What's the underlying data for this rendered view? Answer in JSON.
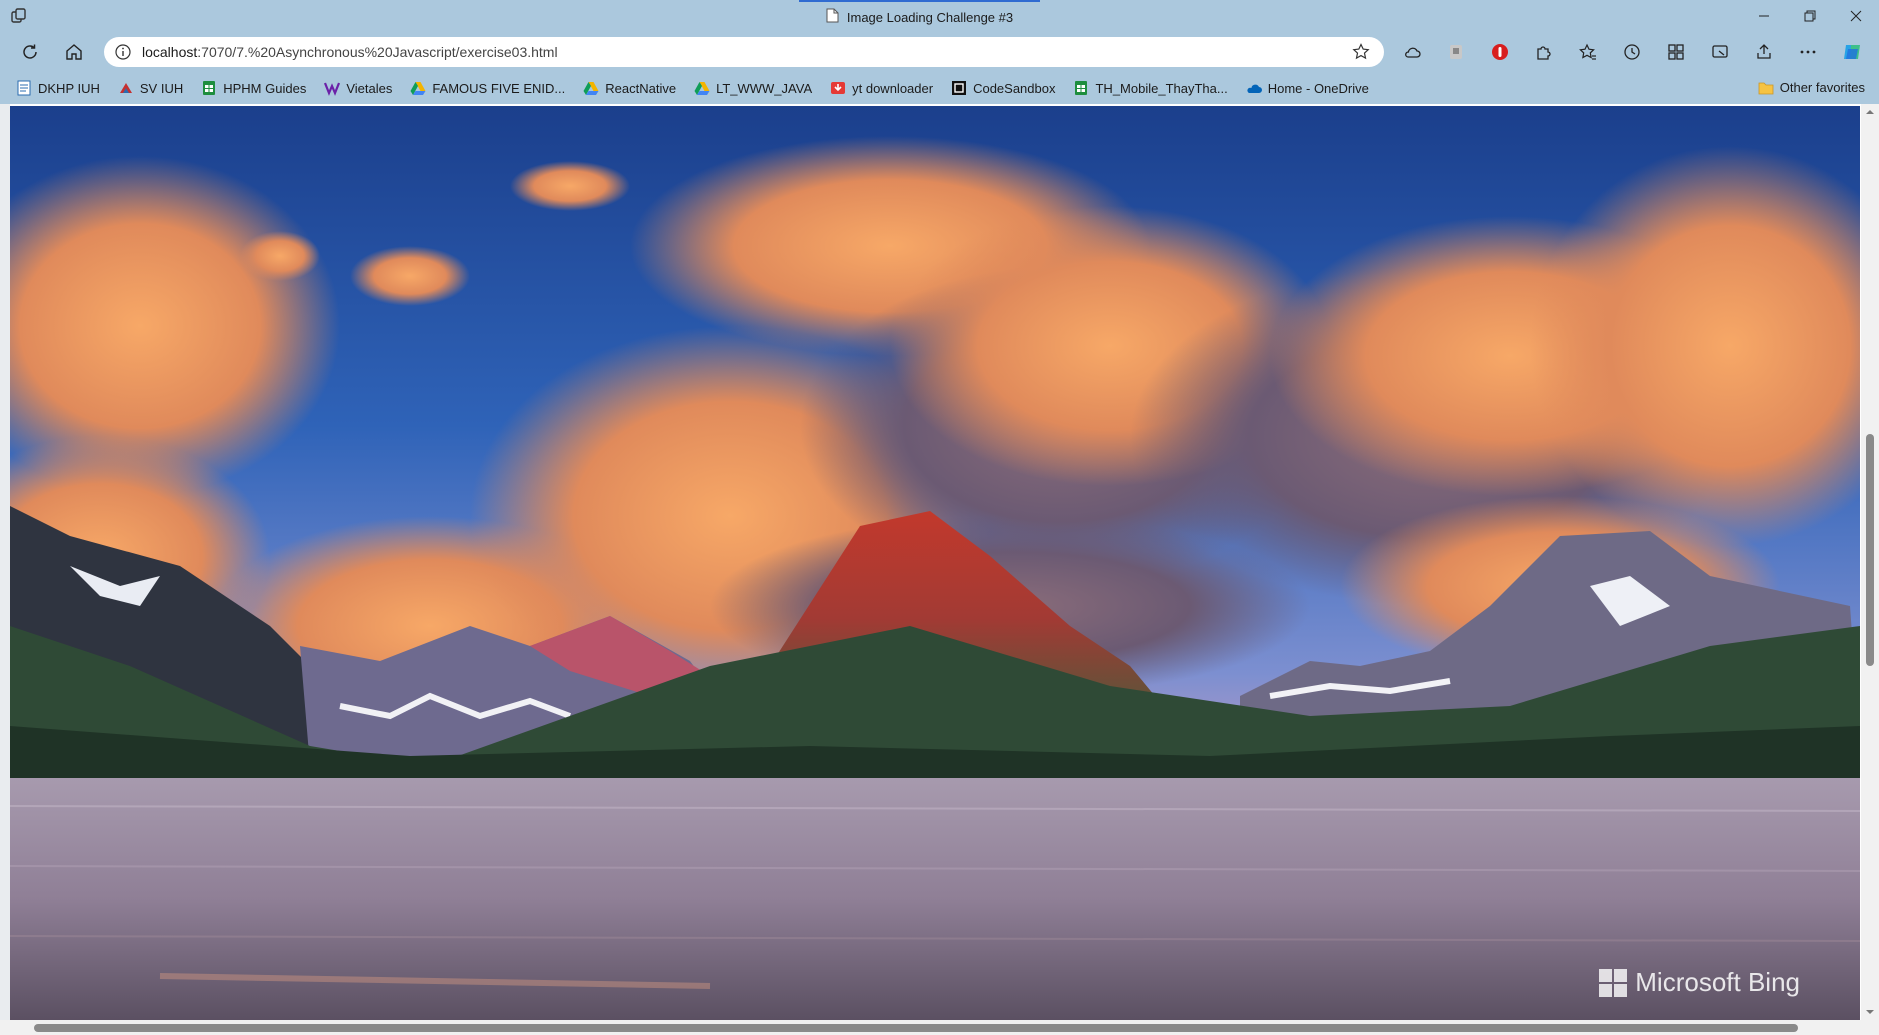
{
  "window": {
    "tab_title": "Image Loading Challenge #3"
  },
  "navbar": {
    "url_host": "localhost",
    "url_path": ":7070/7.%20Asynchronous%20Javascript/exercise03.html"
  },
  "bookmarks": [
    {
      "label": "DKHP IUH",
      "icon": "document-icon",
      "color": "#2b6cb0"
    },
    {
      "label": "SV IUH",
      "icon": "iuh-logo-icon",
      "color": "#c53030"
    },
    {
      "label": "HPHM Guides",
      "icon": "sheets-icon",
      "color": "#1e8e3e"
    },
    {
      "label": "Vietales",
      "icon": "vietales-icon",
      "color": "#6b21a8"
    },
    {
      "label": "FAMOUS FIVE ENID...",
      "icon": "drive-icon",
      "color": "#f4b400"
    },
    {
      "label": "ReactNative",
      "icon": "drive-icon",
      "color": "#0f9d58"
    },
    {
      "label": "LT_WWW_JAVA",
      "icon": "drive-icon",
      "color": "#4285f4"
    },
    {
      "label": "yt downloader",
      "icon": "download-icon",
      "color": "#e53935"
    },
    {
      "label": "CodeSandbox",
      "icon": "codesandbox-icon",
      "color": "#111111"
    },
    {
      "label": "TH_Mobile_ThayTha...",
      "icon": "sheets-icon",
      "color": "#1e8e3e"
    },
    {
      "label": "Home - OneDrive",
      "icon": "onedrive-icon",
      "color": "#0364b8"
    }
  ],
  "other_favorites": "Other favorites",
  "content": {
    "watermark": "Microsoft Bing",
    "image_alt": "Mountain lake at sunset"
  },
  "colors": {
    "chrome": "#abc8dd",
    "accent": "#2f6bd1"
  }
}
